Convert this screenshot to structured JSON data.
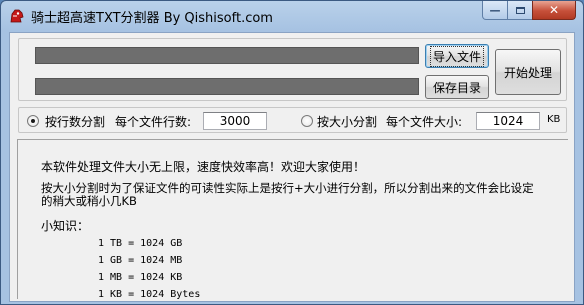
{
  "window": {
    "title": "骑士超高速TXT分割器  By Qishisoft.com"
  },
  "top": {
    "import_button": "导入文件",
    "save_dir_button": "保存目录",
    "start_button": "开始处理"
  },
  "options": {
    "by_lines_label": "按行数分割",
    "lines_per_file_label": "每个文件行数:",
    "lines_per_file_value": "3000",
    "by_size_label": "按大小分割",
    "file_size_label": "每个文件大小:",
    "file_size_value": "1024",
    "file_size_unit": "KB",
    "selected": "by_lines"
  },
  "info": {
    "line1": "本软件处理文件大小无上限，速度快效率高！欢迎大家使用！",
    "line2a": "按大小分割时为了保证文件的可读性实际上是按行+大小进行分割，所以分割出来的文件会比设定",
    "line2b": "的稍大或稍小几KB",
    "tips_title": "小知识：",
    "units": [
      "1 TB = 1024 GB",
      "1 GB = 1024 MB",
      "1 MB = 1024 KB",
      "1 KB = 1024 Bytes"
    ]
  }
}
